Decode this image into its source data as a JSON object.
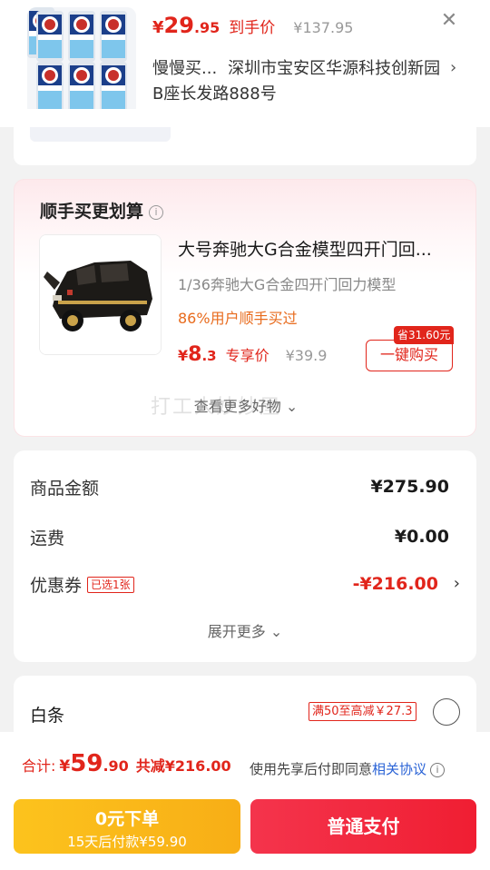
{
  "product": {
    "price_currency": "¥",
    "price_int": "29",
    "price_dec": ".95",
    "price_tag": "到手价",
    "original_price": "¥137.95",
    "close_icon": "close-icon"
  },
  "address": {
    "name": "慢慢买...",
    "detail": "深圳市宝安区华源科技创新园B座长发路888号"
  },
  "addon": {
    "title": "顺手买更划算",
    "item_name": "大号奔驰大G合金模型四开门回...",
    "item_sub": "1/36奔驰大G合金四开门回力模型",
    "popularity": "86%用户顺手买过",
    "price_currency": "¥",
    "price_int": "8",
    "price_dec": ".3",
    "price_tag": "专享价",
    "original_price": "¥39.9",
    "save_badge": "省31.60元",
    "buy_label": "一键购买",
    "see_more": "查看更多好物 ⌄",
    "watermark": "打工人妙妙屋"
  },
  "summary": {
    "rows": [
      {
        "label": "商品金额",
        "value": "¥275.90"
      },
      {
        "label": "运费",
        "value": "¥0.00"
      },
      {
        "label": "优惠券",
        "tag": "已选1张",
        "value": "-¥216.00"
      }
    ],
    "expand_label": "展开更多 ⌄"
  },
  "baitiao": {
    "label": "白条",
    "promo": "满50至高减￥27.3"
  },
  "bottom": {
    "total_label": "合计:",
    "total_currency": "¥",
    "total_int": "59",
    "total_dec": ".90",
    "total_saved": "共减¥216.00",
    "agree_prefix": "使用先享后付即同意",
    "agree_link": "相关协议",
    "zero_line1": "0元下单",
    "zero_line2": "15天后付款¥59.90",
    "pay_label": "普通支付"
  },
  "colors": {
    "accent_red": "#e1251b",
    "pay_red": "#f01e32",
    "zero_yellow": "#f8ae16",
    "link_blue": "#2a63d6"
  }
}
